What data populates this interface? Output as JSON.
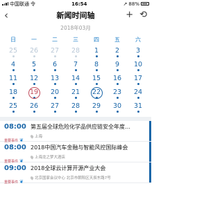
{
  "status": {
    "carrier": "中国联通",
    "network": "令",
    "time": "16:54",
    "location_glyph": "↗",
    "battery": "88%"
  },
  "nav": {
    "back": "‹",
    "title": "新闻时间轴",
    "add": "+",
    "refresh": "⟲"
  },
  "calendar": {
    "month_label": "2018年03月",
    "weekdays": [
      "日",
      "一",
      "二",
      "三",
      "四",
      "五",
      "六"
    ],
    "weeks": [
      [
        {
          "d": "25",
          "m": true
        },
        {
          "d": "26",
          "m": true
        },
        {
          "d": "27",
          "m": true
        },
        {
          "d": "28",
          "m": true
        },
        {
          "d": "1"
        },
        {
          "d": "2"
        },
        {
          "d": "3"
        }
      ],
      [
        {
          "d": "4"
        },
        {
          "d": "5"
        },
        {
          "d": "6"
        },
        {
          "d": "7"
        },
        {
          "d": "8"
        },
        {
          "d": "9"
        },
        {
          "d": "10"
        }
      ],
      [
        {
          "d": "11"
        },
        {
          "d": "12"
        },
        {
          "d": "13"
        },
        {
          "d": "14"
        },
        {
          "d": "15"
        },
        {
          "d": "16"
        },
        {
          "d": "17"
        }
      ],
      [
        {
          "d": "18"
        },
        {
          "d": "19",
          "today": true
        },
        {
          "d": "20"
        },
        {
          "d": "21"
        },
        {
          "d": "22",
          "selected": true
        },
        {
          "d": "23"
        },
        {
          "d": "24"
        }
      ],
      [
        {
          "d": "25"
        },
        {
          "d": "26"
        },
        {
          "d": "27"
        },
        {
          "d": "28"
        },
        {
          "d": "29"
        },
        {
          "d": "30"
        },
        {
          "d": "31"
        }
      ]
    ]
  },
  "events": [
    {
      "time": "08:00",
      "tag": "重要事件",
      "title": "第五届全球危险化学品供应链安全年度…",
      "location": "上海"
    },
    {
      "time": "08:00",
      "tag": "重要事件",
      "title": "2018中国汽车金融与智能风控国际峰会",
      "location": "上海龙之梦大酒店"
    },
    {
      "time": "09:00",
      "tag": "重要事件",
      "title": "2018全球云计算开源产业大会",
      "location": "北京国家会议中心 北京市朝阳区天辰东路7号"
    }
  ],
  "colors": {
    "accent": "#1a66a8",
    "today": "#c04b5b",
    "muted": "#b8c7d6"
  }
}
